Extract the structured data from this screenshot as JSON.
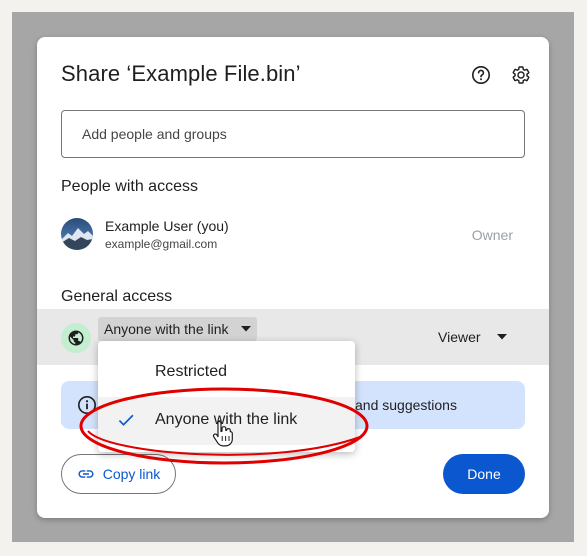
{
  "dialog": {
    "title": "Share ‘Example File.bin’",
    "help_icon": "help-circle-icon",
    "settings_icon": "gear-icon"
  },
  "add_people": {
    "placeholder": "Add people and groups"
  },
  "people_with_access": {
    "heading": "People with access",
    "users": [
      {
        "name": "Example User (you)",
        "email": "example@gmail.com",
        "role": "Owner"
      }
    ]
  },
  "general_access": {
    "heading": "General access",
    "selected": "Anyone with the link",
    "role": "Viewer",
    "options": [
      "Restricted",
      "Anyone with the link"
    ],
    "checked_option": "Anyone with the link"
  },
  "info_banner": {
    "text": "and suggestions"
  },
  "footer": {
    "copy_link_label": "Copy link",
    "done_label": "Done"
  },
  "colors": {
    "primary": "#0b57d0",
    "globe_bg": "#c4eed0",
    "banner_bg": "#d3e3fd",
    "annotation": "#e00000"
  }
}
